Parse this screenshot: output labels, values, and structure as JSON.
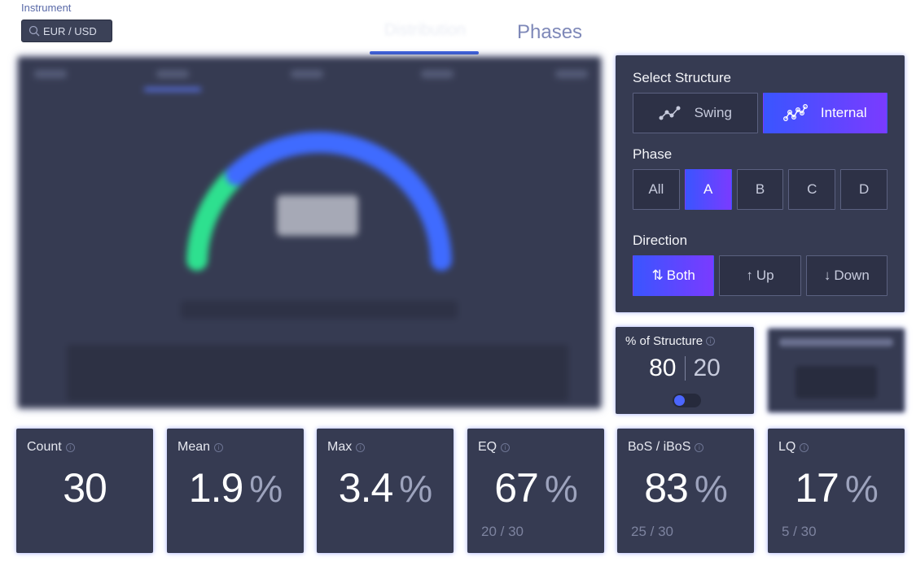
{
  "instrument": {
    "label": "Instrument",
    "value": "EUR / USD"
  },
  "tabs": [
    {
      "label": "Distribution",
      "active": true
    },
    {
      "label": "Phases",
      "active": false
    }
  ],
  "structure": {
    "label": "Select Structure",
    "options": [
      {
        "label": "Swing",
        "icon": "swing-chart-icon",
        "active": false
      },
      {
        "label": "Internal",
        "icon": "internal-chart-icon",
        "active": true
      }
    ]
  },
  "phase": {
    "label": "Phase",
    "options": [
      "All",
      "A",
      "B",
      "C",
      "D"
    ],
    "selected": "A"
  },
  "direction": {
    "label": "Direction",
    "options": [
      {
        "label": "Both",
        "icon": "arrows-up-down-icon",
        "glyph": "⇅",
        "active": true
      },
      {
        "label": "Up",
        "icon": "arrow-up-icon",
        "glyph": "↑",
        "active": false
      },
      {
        "label": "Down",
        "icon": "arrow-down-icon",
        "glyph": "↓",
        "active": false
      }
    ]
  },
  "pct_structure": {
    "title": "% of Structure",
    "left": "80",
    "right": "20"
  },
  "stats": [
    {
      "title": "Count",
      "value": "30",
      "unit": "",
      "sub": ""
    },
    {
      "title": "Mean",
      "value": "1.9",
      "unit": "%",
      "sub": ""
    },
    {
      "title": "Max",
      "value": "3.4",
      "unit": "%",
      "sub": ""
    },
    {
      "title": "EQ",
      "value": "67",
      "unit": "%",
      "sub": "20 / 30"
    },
    {
      "title": "BoS / iBoS",
      "value": "83",
      "unit": "%",
      "sub": "25 / 30"
    },
    {
      "title": "LQ",
      "value": "17",
      "unit": "%",
      "sub": "5 / 30"
    }
  ],
  "colors": {
    "accent": "#3a55ff",
    "accent_end": "#7a3bff",
    "card_bg": "#363b52",
    "gauge_green": "#2ee08f",
    "gauge_blue": "#3f6bff"
  }
}
